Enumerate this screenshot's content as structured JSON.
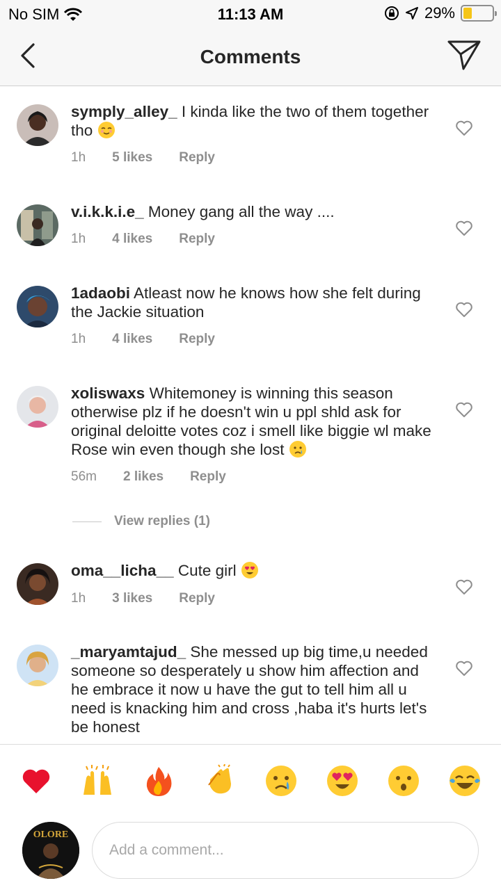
{
  "status_bar": {
    "carrier": "No SIM",
    "time": "11:13 AM",
    "battery": "29%",
    "battery_level": 0.29
  },
  "header": {
    "title": "Comments"
  },
  "comments": [
    {
      "username": "symply_alley_",
      "text": "I kinda like the two of them together tho",
      "emoji": "relieved-face",
      "time": "1h",
      "likes": "5 likes",
      "reply": "Reply"
    },
    {
      "username": "v.i.k.k.i.e_",
      "text": "Money gang all the way ....",
      "time": "1h",
      "likes": "4 likes",
      "reply": "Reply"
    },
    {
      "username": "1adaobi",
      "text": "Atleast now he knows how she felt during the Jackie situation",
      "time": "1h",
      "likes": "4 likes",
      "reply": "Reply"
    },
    {
      "username": "xoliswaxs",
      "text": "Whitemoney is winning this season otherwise plz if he doesn't win u ppl shld ask for original deloitte votes coz i smell like biggie wl make Rose win even though she lost",
      "emoji": "crying-face",
      "time": "56m",
      "likes": "2 likes",
      "reply": "Reply",
      "view_replies": "View replies (1)"
    },
    {
      "username": "oma__licha__",
      "text": "Cute girl",
      "emoji": "heart-eyes-face",
      "time": "1h",
      "likes": "3 likes",
      "reply": "Reply"
    },
    {
      "username": "_maryamtajud_",
      "text": "She messed up big time,u needed someone so desperately u show him affection and he embrace it now u have the gut to tell him all u need is knacking him and cross ,haba it's hurts let's be honest"
    }
  ],
  "reactions": [
    "red-heart",
    "raising-hands",
    "fire",
    "clapping-hands",
    "crying-face",
    "heart-eyes-face",
    "astonished-face",
    "tears-of-joy-face"
  ],
  "composer": {
    "placeholder": "Add a comment...",
    "avatar_text": "OLORE"
  },
  "colors": {
    "text": "#262626",
    "muted": "#8e8e8e",
    "border": "#dbdbdb",
    "header_bg": "#f7f7f7",
    "battery": "#f5c518"
  }
}
